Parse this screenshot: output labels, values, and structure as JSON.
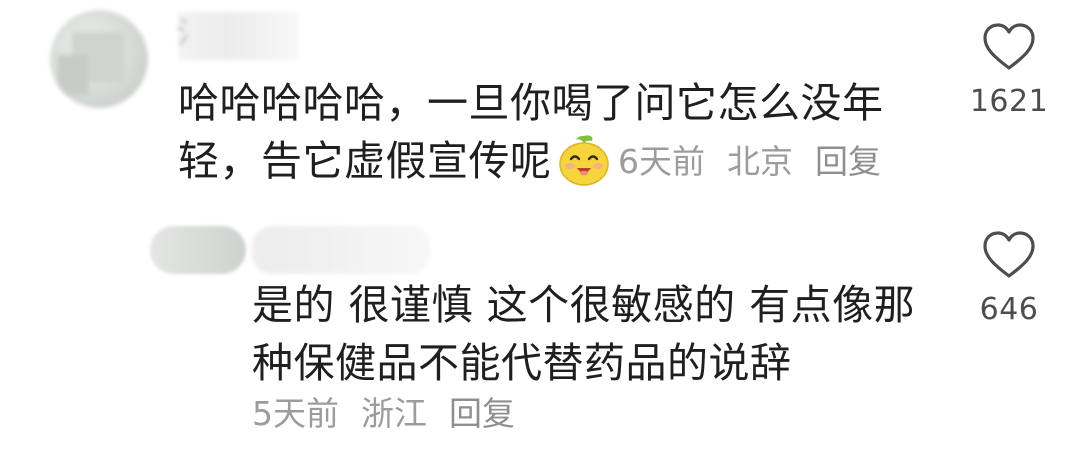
{
  "comments": [
    {
      "text_line1": "哈哈哈哈哈，一旦你喝了问它怎么没年",
      "text_line2": "轻，告它虚假宣传呢",
      "emoji_icon": "smiling-lemon-emoji",
      "time": "6天前",
      "location": "北京",
      "reply_label": "回复",
      "like_count": "1621"
    },
    {
      "text_line1": "是的 很谨慎 这个很敏感的 有点像那",
      "text_line2": "种保健品不能代替药品的说辞",
      "time": "5天前",
      "location": "浙江",
      "reply_label": "回复",
      "like_count": "646"
    }
  ],
  "icons": {
    "like": "heart-outline-icon"
  },
  "colors": {
    "text": "#1f1f1f",
    "meta": "#9c9c9c",
    "like_count": "#4d4d4d",
    "background": "#ffffff"
  }
}
